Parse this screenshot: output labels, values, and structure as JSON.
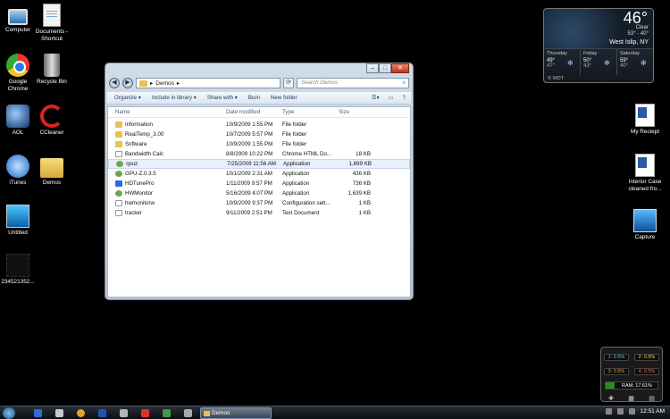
{
  "desktop": {
    "left_icons": [
      {
        "label": "Computer",
        "icon": "computer-icon"
      },
      {
        "label": "Documents - Shortcut",
        "icon": "documents-shortcut-icon"
      },
      {
        "label": "Google Chrome",
        "icon": "chrome-icon"
      },
      {
        "label": "Recycle Bin",
        "icon": "recycle-bin-icon"
      },
      {
        "label": "AOL",
        "icon": "aol-icon"
      },
      {
        "label": "CCleaner",
        "icon": "ccleaner-icon"
      },
      {
        "label": "iTunes",
        "icon": "itunes-icon"
      },
      {
        "label": "Demos",
        "icon": "folder-icon"
      },
      {
        "label": "Untitled",
        "icon": "image-file-icon"
      },
      {
        "label": "234521352...",
        "icon": "file-icon"
      }
    ],
    "right_icons": [
      {
        "label": "My Reciept",
        "icon": "wordpad-doc-icon"
      },
      {
        "label": "Interior Case cleaned fro...",
        "icon": "wordpad-doc-icon"
      },
      {
        "label": "Capture",
        "icon": "image-file-icon"
      }
    ]
  },
  "weather": {
    "temp": "46°",
    "condition": "Clear",
    "hilo": "53° - 40°",
    "city": "West Islip, NY",
    "days": [
      {
        "name": "Thursday",
        "hi": "49°",
        "lo": "47°"
      },
      {
        "name": "Friday",
        "hi": "50°",
        "lo": "43°"
      },
      {
        "name": "Saturday",
        "hi": "59°",
        "lo": "40°"
      }
    ],
    "brand": "© WDT"
  },
  "cpu_meter": {
    "cores": [
      {
        "label": "1: 0.5%"
      },
      {
        "label": "2: 0.5%"
      },
      {
        "label": "3: 0.5%"
      },
      {
        "label": "4: 0.5%"
      }
    ],
    "ram_label": "RAM: 17.61%",
    "ram_fraction": 0.1761
  },
  "explorer": {
    "address_path": "Demos",
    "search_placeholder": "Search Demos",
    "toolbar": {
      "organize": "Organize ▾",
      "include": "Include in library ▾",
      "share": "Share with ▾",
      "burn": "Burn",
      "new_folder": "New folder"
    },
    "columns": {
      "name": "Name",
      "date": "Date modified",
      "type": "Type",
      "size": "Size"
    },
    "files": [
      {
        "name": "Information",
        "date": "10/9/2009 1:55 PM",
        "type": "File folder",
        "size": "",
        "kind": "folder"
      },
      {
        "name": "RealTemp_3.00",
        "date": "10/7/2009 5:57 PM",
        "type": "File folder",
        "size": "",
        "kind": "folder"
      },
      {
        "name": "Software",
        "date": "10/9/2009 1:55 PM",
        "type": "File folder",
        "size": "",
        "kind": "folder"
      },
      {
        "name": "Bandwidth Calc",
        "date": "8/8/2009 10:22 PM",
        "type": "Chrome HTML Do...",
        "size": "18 KB",
        "kind": "doc"
      },
      {
        "name": "cpuz",
        "date": "7/25/2009 11:56 AM",
        "type": "Application",
        "size": "1,699 KB",
        "kind": "green"
      },
      {
        "name": "GPU-Z.0.3.5",
        "date": "10/1/2009 2:31 AM",
        "type": "Application",
        "size": "436 KB",
        "kind": "green"
      },
      {
        "name": "HDTunePro",
        "date": "1/11/2009 9:57 PM",
        "type": "Application",
        "size": "736 KB",
        "kind": "blue"
      },
      {
        "name": "HWMonitor",
        "date": "5/16/2009 4:07 PM",
        "type": "Application",
        "size": "1,639 KB",
        "kind": "green"
      },
      {
        "name": "hwmonitorw",
        "date": "10/9/2009 9:37 PM",
        "type": "Configuration sett...",
        "size": "1 KB",
        "kind": "doc"
      },
      {
        "name": "tracker",
        "date": "9/11/2009 2:51 PM",
        "type": "Text Document",
        "size": "1 KB",
        "kind": "doc"
      }
    ]
  },
  "taskbar": {
    "task_label": "Demos",
    "clock": "12:51 AM"
  }
}
